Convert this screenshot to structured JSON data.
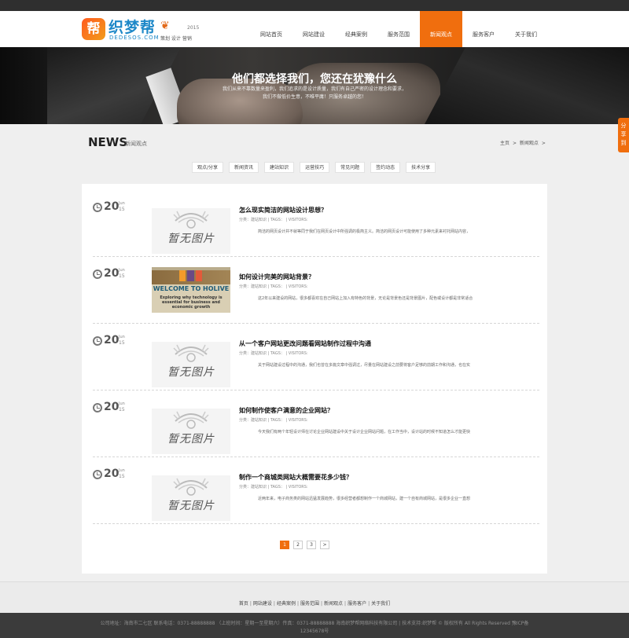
{
  "logo": {
    "mark": "帮",
    "name": "织梦帮",
    "domain": "DEDESOS.COM",
    "year": "2015",
    "tags": "策划 设计 营销"
  },
  "nav": [
    {
      "label": "网站首页",
      "active": false
    },
    {
      "label": "网站建设",
      "active": false
    },
    {
      "label": "经典案例",
      "active": false
    },
    {
      "label": "服务范围",
      "active": false
    },
    {
      "label": "新闻观点",
      "active": true
    },
    {
      "label": "服务客户",
      "active": false
    },
    {
      "label": "关于我们",
      "active": false
    }
  ],
  "banner": {
    "title": "他们都选择我们，您还在犹豫什么",
    "sub1": "我们从来不靠数量来盈利，我们追求的是设计质量，我们有自己严密的设计理念和要求，",
    "sub2": "我们不做低价生意，不唯平庸！只服务卓越的您！"
  },
  "float_tab": "分享到",
  "section": {
    "title": "NEWS",
    "subtitle": "新闻观点"
  },
  "breadcrumb": {
    "home": "主页",
    "sep1": ">",
    "current": "新闻观点",
    "sep2": ">"
  },
  "categories": [
    "观点/分享",
    "新闻资讯",
    "建站知识",
    "运营技巧",
    "常见问题",
    "签约动态",
    "技术分享"
  ],
  "no_image_text": "暂无图片",
  "articles": [
    {
      "day": "20",
      "month": "Jun",
      "year": "15",
      "title": "怎么现实简洁的网站设计思想？",
      "meta": "分类：建站知识 | TAGS： | VISITORS:",
      "desc": "简洁的网页设计并不就等同于我们在网页设计中所强调的极简主义。简洁的网页设计可能使用了多种元素来衬托网站内容，",
      "image": "none"
    },
    {
      "day": "20",
      "month": "Jun",
      "year": "15",
      "title": "如何设计完美的网站背景？",
      "meta": "分类：建站知识 | TAGS： | VISITORS:",
      "desc": "这2年以来建设的网站，很多都喜欢在自己网站上加入有特色的背景，无论是背景色还是背景图片，配色或设计都是非常适合",
      "image": "photo",
      "photo_head": "WELCOME TO HOLIVE",
      "photo_sub": "Exploring why technology is essential for business and economic growth"
    },
    {
      "day": "20",
      "month": "Jun",
      "year": "15",
      "title": "从一个客户网站更改问题看网站制作过程中沟通",
      "meta": "分类：建站知识 | TAGS： | VISITORS:",
      "desc": "关于网站建设过程中的沟通，我们也曾在多篇文章中强调过，尽量在网站建设之前要将客户足够的前期工作和沟通，也在实",
      "image": "none"
    },
    {
      "day": "20",
      "month": "Jun",
      "year": "15",
      "title": "如何制作使客户满意的企业网站？",
      "meta": "分类：建站知识 | TAGS： | VISITORS:",
      "desc": "今天我们有两个年轻设计师在讨论企业网站建设中关于设计企业网站问题，在工作当中，设计站的时候不知道怎么才能更快",
      "image": "none"
    },
    {
      "day": "20",
      "month": "Jun",
      "year": "15",
      "title": "制作一个商城类网站大概需要花多少钱？",
      "meta": "分类：建站知识 | TAGS： | VISITORS:",
      "desc": "近两年来，电子商务类的网站迅猛发展趋势，很多经营者都想制作一个商城网站，建一个自有商城网站，是很多企业一直想",
      "image": "none"
    }
  ],
  "pagination": [
    "1",
    "2",
    "3",
    ">"
  ],
  "footer_links": [
    "首页",
    "网站建设",
    "经典案例",
    "服务范围",
    "新闻观点",
    "服务客户",
    "关于我们"
  ],
  "footer_copy1": "公司地址：海南市二七区  联系电话：0371-88888888  （上班时间：星期一至星期六）传真：0371-88888888  海南织梦帮网络科技有限公司 | 技术支持:织梦帮 © 版权所有 All Rights Reserved  豫ICP备",
  "footer_copy2": "12345678号",
  "colors": {
    "accent": "#f06e0e",
    "dark": "#3b3b3b"
  }
}
